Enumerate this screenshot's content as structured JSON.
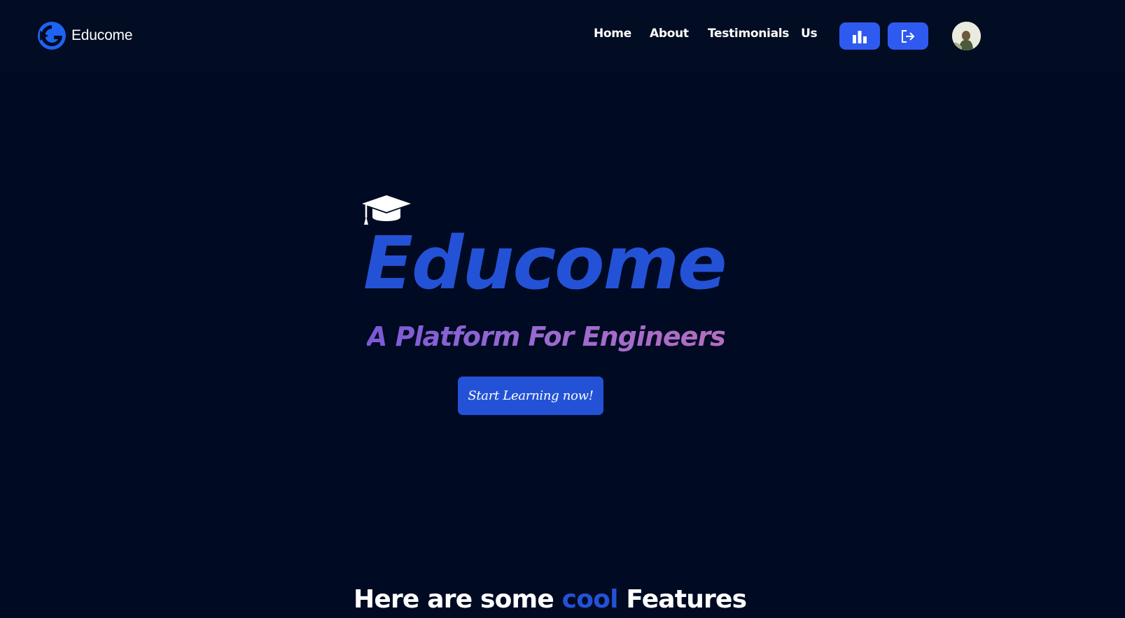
{
  "navbar": {
    "brand": "Educome",
    "links": [
      {
        "label": "Home"
      },
      {
        "label": "About"
      },
      {
        "label": "Testimonials"
      },
      {
        "label": "Us"
      }
    ],
    "icon_buttons": [
      {
        "icon": "bar-chart-icon"
      },
      {
        "icon": "logout-icon"
      }
    ],
    "avatar_icon": "user-avatar"
  },
  "hero": {
    "cap_icon": "graduation-cap-icon",
    "title": "Educome",
    "subtitle": "A Platform For Engineers",
    "cta_label": "Start Learning now!"
  },
  "features": {
    "heading_before": "Here are some ",
    "heading_accent": "cool",
    "heading_after": " Features"
  },
  "colors": {
    "background": "#000a23",
    "navbar": "#020c22",
    "brand_blue": "#2452d6",
    "button_blue": "#2e5af0",
    "subtitle_gradient_start": "#7a5ad6",
    "subtitle_gradient_end": "#b56ec0",
    "text": "#ffffff"
  }
}
